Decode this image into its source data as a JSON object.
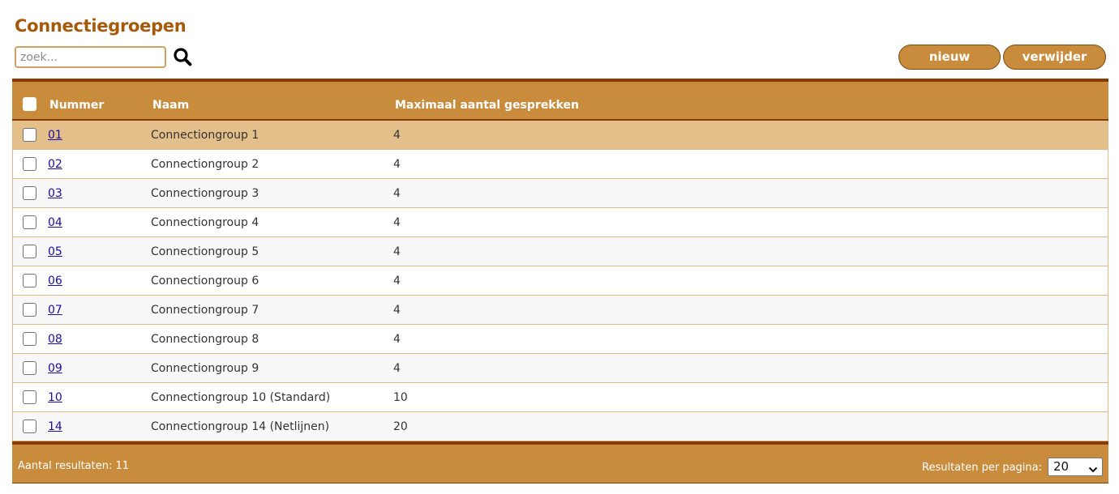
{
  "header": {
    "title": "Connectiegroepen"
  },
  "search": {
    "placeholder": "zoek..."
  },
  "toolbar": {
    "new_label": "nieuw",
    "delete_label": "verwijder"
  },
  "table": {
    "columns": {
      "number": "Nummer",
      "name": "Naam",
      "max": "Maximaal aantal gesprekken"
    },
    "rows": [
      {
        "number": "01",
        "name": "Connectiongroup 1",
        "max": "4"
      },
      {
        "number": "02",
        "name": "Connectiongroup 2",
        "max": "4"
      },
      {
        "number": "03",
        "name": "Connectiongroup 3",
        "max": "4"
      },
      {
        "number": "04",
        "name": "Connectiongroup 4",
        "max": "4"
      },
      {
        "number": "05",
        "name": "Connectiongroup 5",
        "max": "4"
      },
      {
        "number": "06",
        "name": "Connectiongroup 6",
        "max": "4"
      },
      {
        "number": "07",
        "name": "Connectiongroup 7",
        "max": "4"
      },
      {
        "number": "08",
        "name": "Connectiongroup 8",
        "max": "4"
      },
      {
        "number": "09",
        "name": "Connectiongroup 9",
        "max": "4"
      },
      {
        "number": "10",
        "name": "Connectiongroup 10 (Standard)",
        "max": "10"
      },
      {
        "number": "14",
        "name": "Connectiongroup 14 (Netlijnen)",
        "max": "20"
      }
    ]
  },
  "footer": {
    "result_count": "Aantal resultaten: 11",
    "per_page_label": "Resultaten per pagina:",
    "per_page_value": "20"
  },
  "icons": {
    "search": "search-icon",
    "chevron": "chevron-down-icon"
  },
  "colors": {
    "accent": "#c98c3c",
    "accent_dark": "#8a3a06",
    "title": "#a55a0a",
    "selected_row": "#e3bf8a",
    "link": "#1a0dab"
  }
}
